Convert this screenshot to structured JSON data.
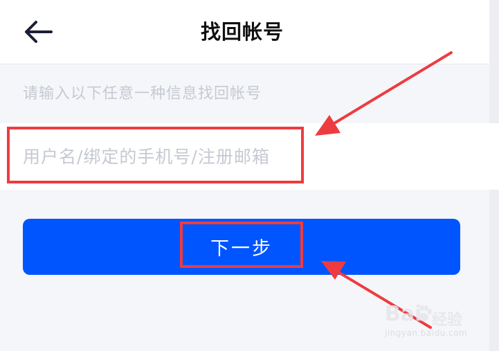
{
  "header": {
    "back_icon": "back-arrow-icon",
    "title": "找回帐号"
  },
  "form": {
    "hint": "请输入以下任意一种信息找回帐号",
    "account_placeholder": "用户名/绑定的手机号/注册邮箱",
    "account_value": "",
    "next_label": "下一步"
  },
  "annotations": {
    "highlight_color": "#EE3B40",
    "arrow_color": "#EE3B40"
  },
  "watermark": {
    "logo_text": "Bai",
    "logo_icon": "paw-icon",
    "brand_cn": "经验",
    "url": "jingyan.baidu.com"
  },
  "colors": {
    "primary": "#0055FF",
    "background": "#F5F6FA",
    "placeholder": "#C5C9D1"
  }
}
